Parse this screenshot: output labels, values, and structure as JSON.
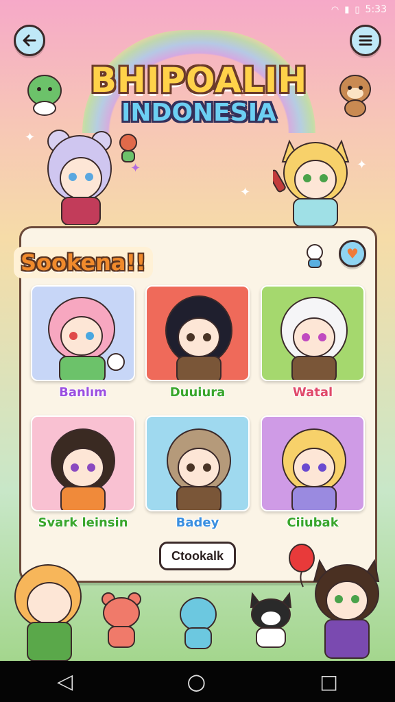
{
  "status_bar": {
    "time": "5:33"
  },
  "header": {
    "back_icon": "back-arrow-icon",
    "menu_icon": "hamburger-menu-icon"
  },
  "logo": {
    "line1": "BHIPOALIH",
    "line2": "INDONESIA"
  },
  "panel": {
    "title": "Sookena!!",
    "cards": [
      {
        "label": "Banlım",
        "label_color": "#9b4fe0",
        "bg": "#c7d6f7"
      },
      {
        "label": "Duuiura",
        "label_color": "#3aa62c",
        "bg": "#ef6a5a"
      },
      {
        "label": "Watal",
        "label_color": "#e04a6a",
        "bg": "#a5d86e"
      },
      {
        "label": "Svark leinsin",
        "label_color": "#3aa62c",
        "bg": "#f9c1d2"
      },
      {
        "label": "Badey",
        "label_color": "#3a8fe0",
        "bg": "#9fd9ef"
      },
      {
        "label": "Ciiubak",
        "label_color": "#3aa62c",
        "bg": "#cf9be6"
      }
    ],
    "action_button": "Ctookalk"
  },
  "navigation": {
    "back": "◁",
    "home": "○",
    "recents": "□"
  }
}
